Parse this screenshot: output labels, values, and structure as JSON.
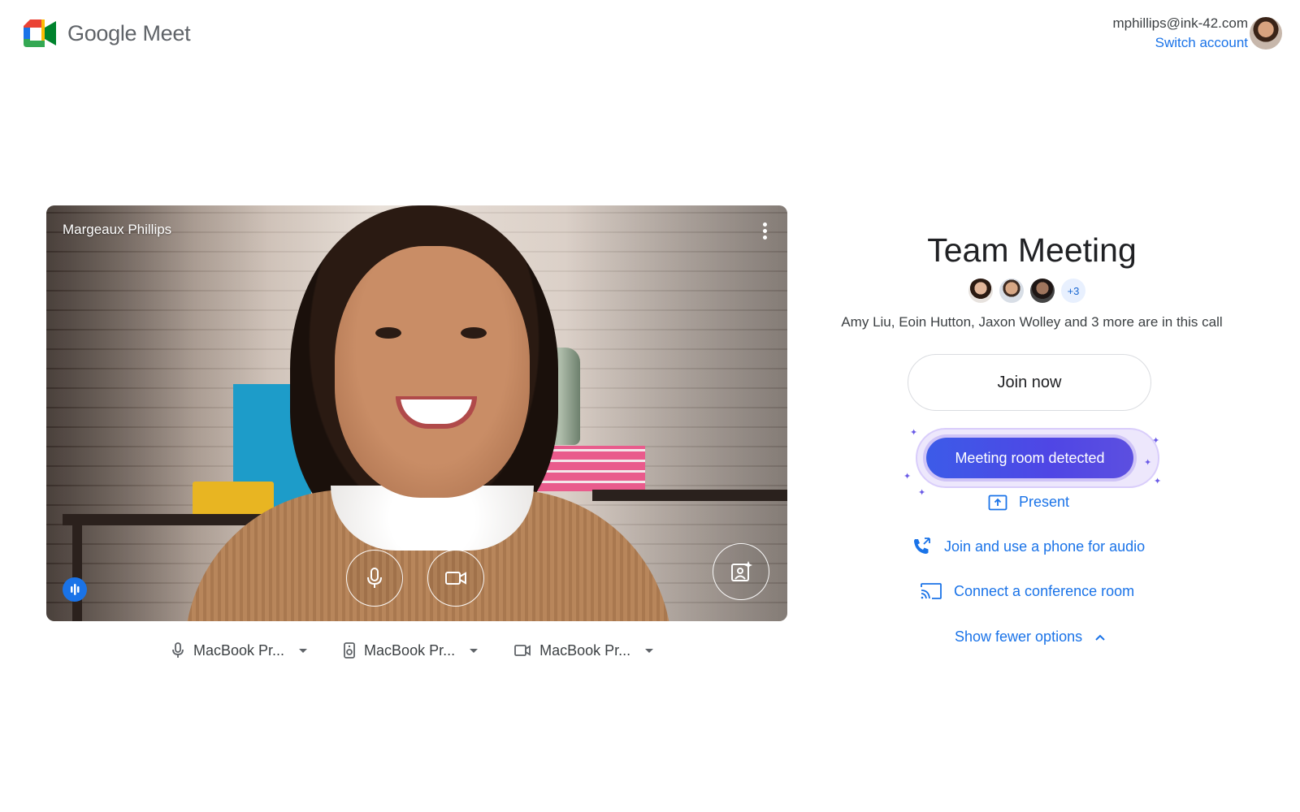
{
  "header": {
    "app_name": "Google Meet",
    "account_email": "mphillips@ink-42.com",
    "switch_account_label": "Switch account"
  },
  "preview": {
    "participant_name": "Margeaux Phillips"
  },
  "devices": [
    {
      "icon": "microphone-icon",
      "label": "MacBook Pr..."
    },
    {
      "icon": "speaker-icon",
      "label": "MacBook Pr..."
    },
    {
      "icon": "camera-icon",
      "label": "MacBook Pr..."
    }
  ],
  "meeting": {
    "title": "Team Meeting",
    "more_count": "+3",
    "in_call_text": "Amy Liu, Eoin Hutton, Jaxon Wolley and 3 more are in this call",
    "join_label": "Join now",
    "room_detected_label": "Meeting room detected",
    "present_label": "Present",
    "phone_audio_label": "Join and use a phone for audio",
    "conference_room_label": "Connect a conference room",
    "fewer_options_label": "Show fewer options"
  },
  "colors": {
    "accent": "#1a73e8",
    "room_detected": "#4f46e5"
  }
}
